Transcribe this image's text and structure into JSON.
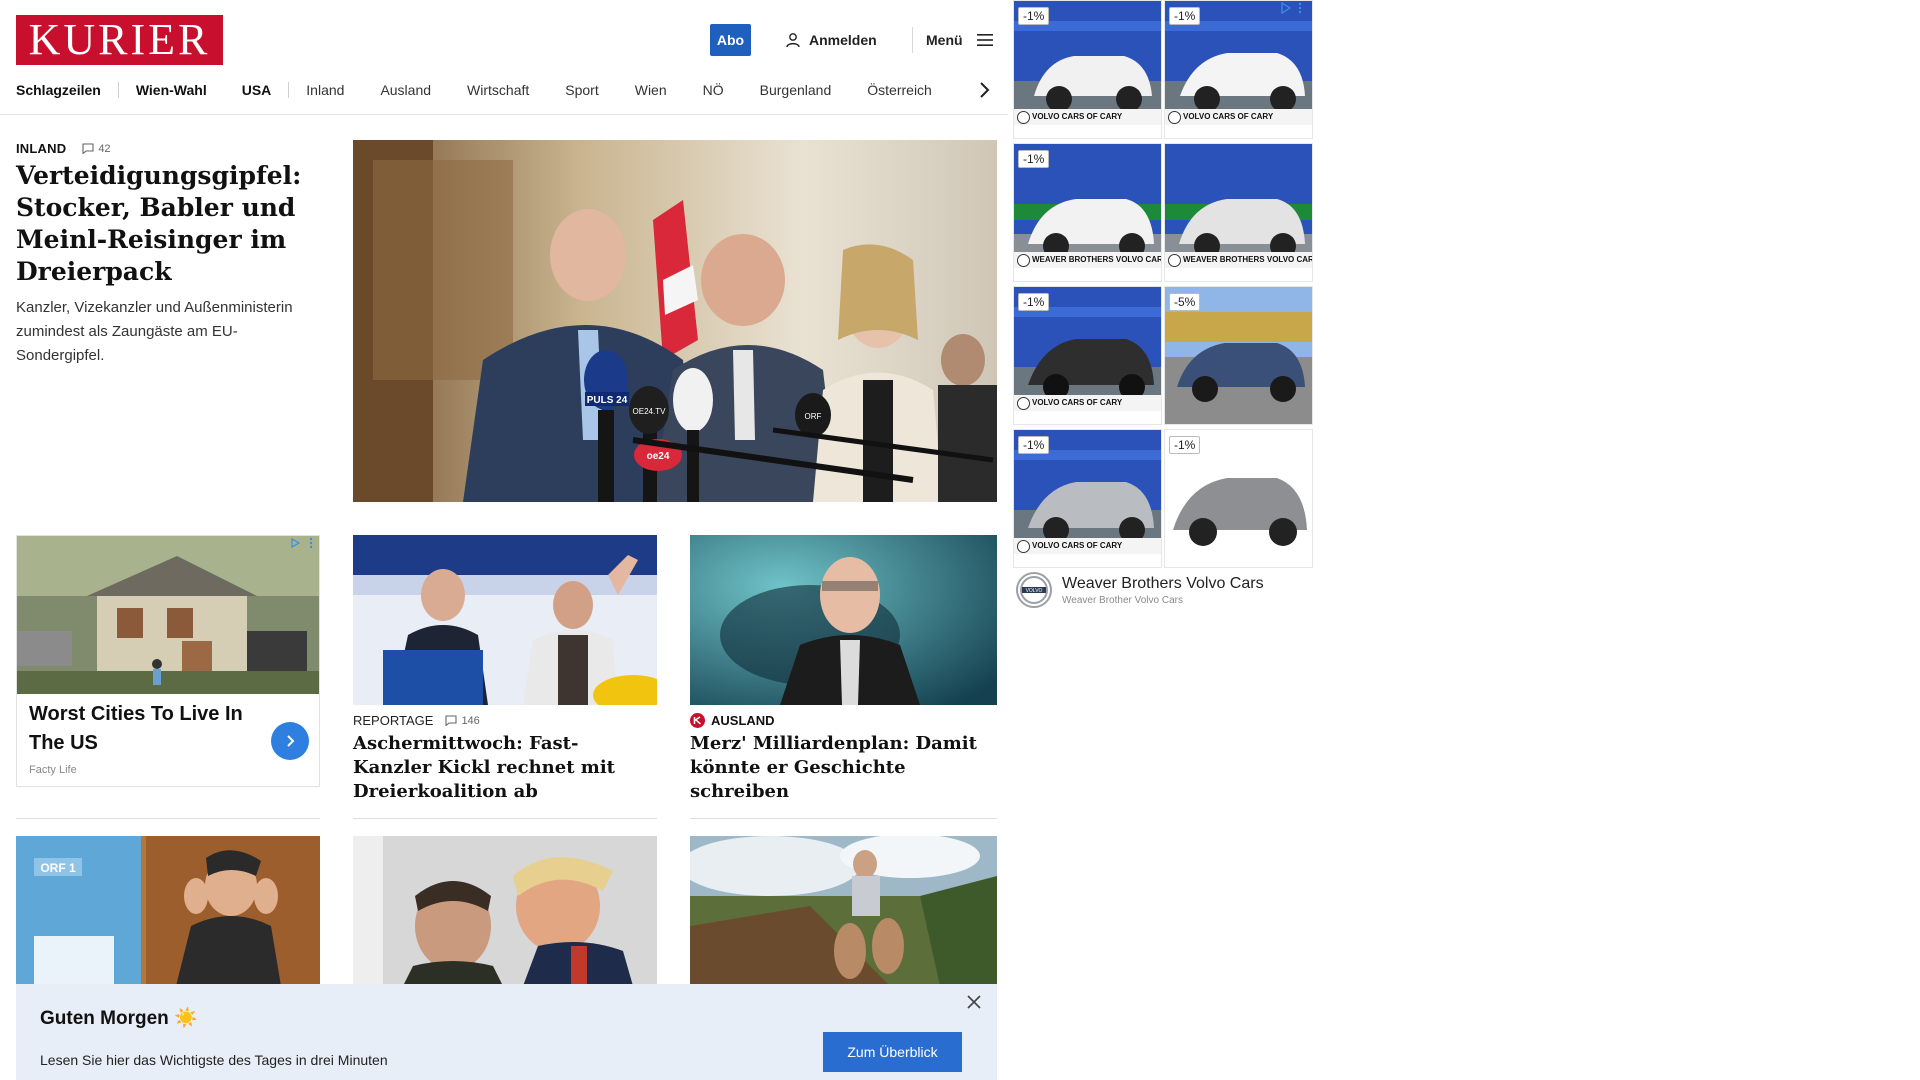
{
  "header": {
    "logo": "KURIER",
    "abo_label": "Abo",
    "login_label": "Anmelden",
    "menu_label": "Menü"
  },
  "nav": {
    "items": [
      "Schlagzeilen",
      "Wien-Wahl",
      "USA",
      "Inland",
      "Ausland",
      "Wirtschaft",
      "Sport",
      "Wien",
      "NÖ",
      "Burgenland",
      "Österreich"
    ]
  },
  "hero": {
    "category": "INLAND",
    "comments": "42",
    "title": "Verteidigungsgipfel: Stocker, Babler und Meinl-Reisinger im Dreierpack",
    "lead": "Kanzler, Vizekanzler und Außenministerin zumindest als Zaungäste am EU-Sondergipfel.",
    "mic_labels": [
      "PULS 24",
      "OE24.TV",
      "oe24",
      "ORF"
    ]
  },
  "ad_left": {
    "title": "Worst Cities To Live In The US",
    "source": "Facty Life"
  },
  "cards": [
    {
      "category": "REPORTAGE",
      "comments": "146",
      "title": "Aschermittwoch: Fast-Kanzler Kickl rechnet mit Dreierkoalition ab"
    },
    {
      "category": "AUSLAND",
      "title": "Merz' Milliardenplan: Damit könnte er Geschichte schreiben"
    }
  ],
  "row3_labels": {
    "orf": "ORF 1"
  },
  "ad_grid": {
    "tiles": [
      {
        "badge": "-1%",
        "brand": "VOLVO CARS OF CARY"
      },
      {
        "badge": "-1%",
        "brand": "VOLVO CARS OF CARY"
      },
      {
        "badge": "-1%",
        "brand": "WEAVER BROTHERS VOLVO CARS"
      },
      {
        "badge": "",
        "brand": "WEAVER BROTHERS VOLVO CARS"
      },
      {
        "badge": "-1%",
        "brand": "VOLVO CARS OF CARY"
      },
      {
        "badge": "-5%",
        "brand": ""
      },
      {
        "badge": "-1%",
        "brand": "VOLVO CARS OF CARY"
      },
      {
        "badge": "-1%",
        "brand": ""
      }
    ],
    "advertiser": "Weaver Brothers Volvo Cars",
    "advertiser_sub": "Weaver Brother Volvo Cars",
    "logo_text": "VOLVO"
  },
  "banner": {
    "title": "Guten Morgen ☀️",
    "text": "Lesen Sie hier das Wichtigste des Tages in drei Minuten",
    "button": "Zum Überblick"
  },
  "colors": {
    "brand": "#c8102e",
    "accent": "#1f5fbd",
    "banner_bg": "#e8eef7"
  }
}
